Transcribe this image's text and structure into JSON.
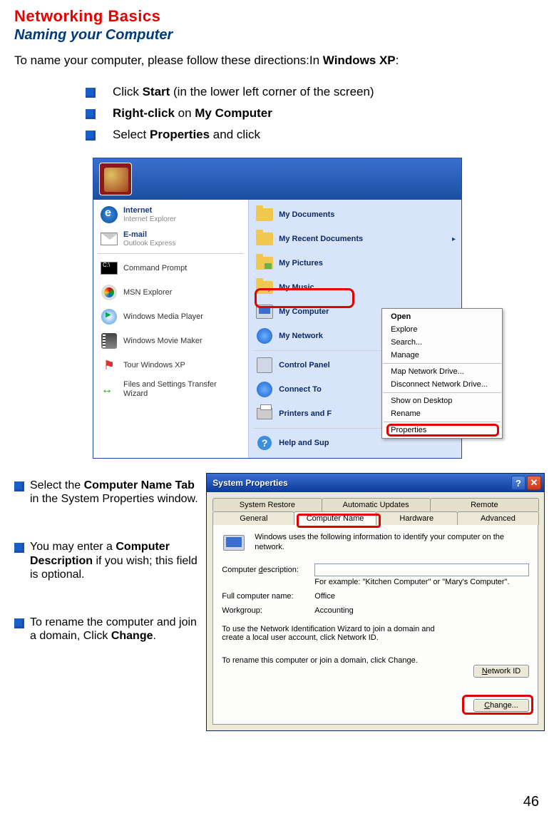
{
  "page_number": "46",
  "header": {
    "title": "Networking Basics",
    "subtitle": "Naming your Computer"
  },
  "intro": {
    "pre": "To name your computer, please follow these directions:In ",
    "bold": "Windows XP",
    "post": ":"
  },
  "top_bullets": [
    {
      "pre": "Click ",
      "b1": "Start",
      "post": " (in the lower left corner of the screen)"
    },
    {
      "b1": "Right-click",
      "mid": " on ",
      "b2": "My Computer"
    },
    {
      "pre": "Select ",
      "b1": "Properties",
      "post": " and click"
    }
  ],
  "start_menu": {
    "left": [
      {
        "title": "Internet",
        "sub": "Internet Explorer",
        "icon": "ie"
      },
      {
        "title": "E-mail",
        "sub": "Outlook Express",
        "icon": "mail"
      },
      {
        "sep": true
      },
      {
        "title": "Command Prompt",
        "icon": "cmd"
      },
      {
        "title": "MSN Explorer",
        "icon": "msn"
      },
      {
        "title": "Windows Media Player",
        "icon": "wmp"
      },
      {
        "title": "Windows Movie Maker",
        "icon": "wmm"
      },
      {
        "title": "Tour Windows XP",
        "icon": "flag"
      },
      {
        "title": "Files and Settings Transfer Wizard",
        "icon": "wiz"
      }
    ],
    "right": [
      {
        "title": "My Documents",
        "icon": "folder"
      },
      {
        "title": "My Recent Documents",
        "icon": "folder",
        "arrow": true
      },
      {
        "title": "My Pictures",
        "icon": "folder",
        "cls": "ic-pic"
      },
      {
        "title": "My Music",
        "icon": "folder",
        "cls": "ic-music"
      },
      {
        "title": "My Computer",
        "icon": "mycomp",
        "hl": true
      },
      {
        "title": "My Network",
        "icon": "net",
        "trunc": true
      },
      {
        "sep": true
      },
      {
        "title": "Control Panel",
        "icon": "cpanel",
        "trunc": true
      },
      {
        "title": "Connect To",
        "icon": "net",
        "trunc": true
      },
      {
        "title": "Printers and F",
        "icon": "printer",
        "trunc": true
      },
      {
        "sep": true
      },
      {
        "title": "Help and Sup",
        "icon": "help",
        "trunc": true
      }
    ],
    "context_menu": [
      {
        "label": "Open",
        "bold": true
      },
      {
        "label": "Explore"
      },
      {
        "label": "Search..."
      },
      {
        "label": "Manage"
      },
      {
        "sep": true
      },
      {
        "label": "Map Network Drive..."
      },
      {
        "label": "Disconnect Network Drive..."
      },
      {
        "sep": true
      },
      {
        "label": "Show on Desktop"
      },
      {
        "label": "Rename"
      },
      {
        "sep": true
      },
      {
        "label": "Properties",
        "hl": true
      }
    ]
  },
  "left_bullets": [
    {
      "pre": "Select the ",
      "b1": "Computer Name Tab",
      "post": " in the System Properties window."
    },
    {
      "pre": "You may enter a ",
      "b1": "Computer Description",
      "post": " if you wish; this field is optional."
    },
    {
      "pre": "To rename the computer and join a domain, Click ",
      "b1": "Change",
      "post": "."
    }
  ],
  "sysprop": {
    "title": "System Properties",
    "tabs_row1": [
      "System Restore",
      "Automatic Updates",
      "Remote"
    ],
    "tabs_row2": [
      "General",
      "Computer Name",
      "Hardware",
      "Advanced"
    ],
    "active_tab": "Computer Name",
    "desc": "Windows uses the following information to identify your computer on the network.",
    "field_desc_label": "Computer description:",
    "field_desc_underline_char": "d",
    "hint": "For example: \"Kitchen Computer\" or \"Mary's Computer\".",
    "full_name_label": "Full computer name:",
    "full_name_value": "Office",
    "workgroup_label": "Workgroup:",
    "workgroup_value": "Accounting",
    "netid_text": "To use the Network Identification Wizard to join a domain and create a local user account, click Network ID.",
    "netid_button": "Network ID",
    "change_text": "To rename this computer or join a domain, click Change.",
    "change_button": "Change..."
  }
}
